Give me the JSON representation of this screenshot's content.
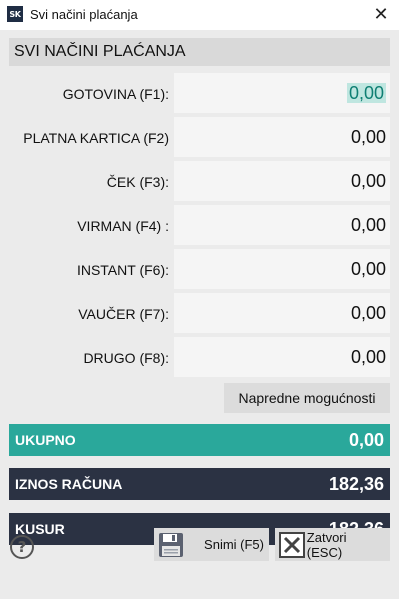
{
  "window": {
    "app_icon_text": "SK",
    "title": "Svi načini plaćanja",
    "close_symbol": "✕"
  },
  "section_title": "SVI NAČINI PLAĆANJA",
  "payments": [
    {
      "label": "GOTOVINA (F1):",
      "value": "0,00"
    },
    {
      "label": "PLATNA KARTICA (F2)",
      "value": "0,00"
    },
    {
      "label": "ČEK (F3):",
      "value": "0,00"
    },
    {
      "label": "VIRMAN (F4) :",
      "value": "0,00"
    },
    {
      "label": "INSTANT (F6):",
      "value": "0,00"
    },
    {
      "label": "VAUČER (F7):",
      "value": "0,00"
    },
    {
      "label": "DRUGO (F8):",
      "value": "0,00"
    }
  ],
  "advanced_button": "Napredne mogućnosti",
  "totals": {
    "ukupno_label": "UKUPNO",
    "ukupno_value": "0,00",
    "iznos_label": "IZNOS RAČUNA",
    "iznos_value": "182,36",
    "kusur_label": "KUSUR",
    "kusur_value": "-182,36"
  },
  "footer": {
    "help_symbol": "?",
    "save_label": "Snimi (F5)",
    "close_label": "Zatvori (ESC)"
  },
  "colors": {
    "ukupno_bg": "#2aa89b",
    "dark_bg": "#2b3243",
    "selection_highlight": "#bfe6e0"
  }
}
